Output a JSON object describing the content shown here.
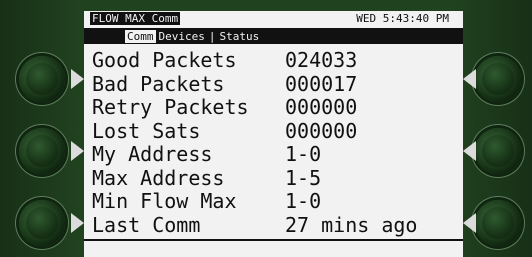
{
  "header": {
    "app_title": "FLOW MAX Comm",
    "clock": "WED 5:43:40 PM"
  },
  "tabs": [
    {
      "label": "Comm",
      "active": true
    },
    {
      "label": "Devices",
      "active": false
    },
    {
      "label": "Status",
      "active": false
    }
  ],
  "rows": [
    {
      "label": "Good Packets",
      "value": "024033"
    },
    {
      "label": "Bad Packets",
      "value": "000017"
    },
    {
      "label": "Retry Packets",
      "value": "000000"
    },
    {
      "label": "Lost Sats",
      "value": "000000"
    },
    {
      "label": "My Address",
      "value": "1-0"
    },
    {
      "label": "Max Address",
      "value": "1-5"
    },
    {
      "label": "Min Flow Max",
      "value": "1-0"
    },
    {
      "label": "Last Comm",
      "value": "27 mins ago"
    }
  ],
  "colors": {
    "bezel": "#21421f",
    "screen": "#f2f2f2",
    "ink": "#111111"
  }
}
